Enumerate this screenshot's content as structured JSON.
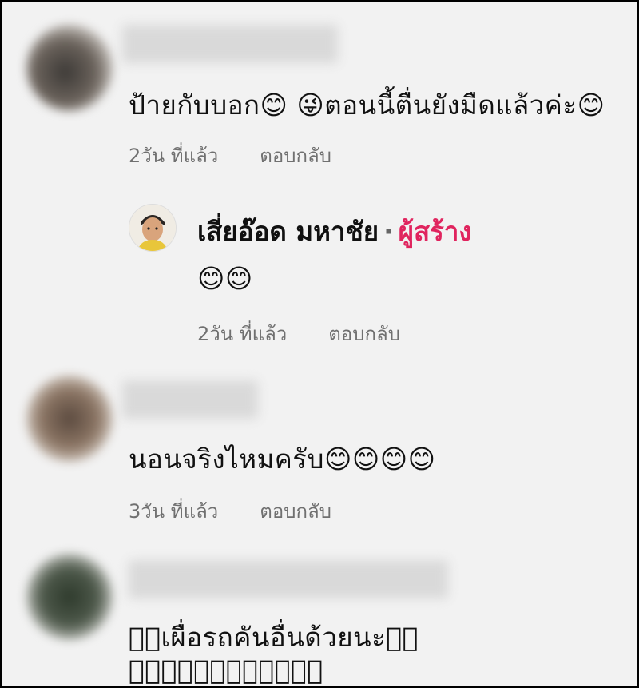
{
  "comments": [
    {
      "text": "ป้ายกับบอก😊 😜ตอนนี้ตื่นยังมืดแล้วค่ะ😊",
      "time": "2วัน ที่แล้ว",
      "reply": "ตอบกลับ",
      "avatar_color": "#4a4743"
    },
    {
      "text": "นอนจริงไหมครับ😊😊😊😊",
      "time": "3วัน ที่แล้ว",
      "reply": "ตอบกลับ",
      "avatar_color": "#5b4a3f"
    },
    {
      "text_line1": "􀀀􀀀เผื่อรถคันอื่นด้วยนะ􀀀􀀀",
      "text_line2": "􀀀􀀀􀀀􀀀􀀀􀀀􀀀􀀀􀀀􀀀􀀀􀀀",
      "avatar_color": "#2e3a2c"
    }
  ],
  "creator_reply": {
    "name": "เสี่ยอ๊อด มหาชัย",
    "separator": "·",
    "badge": "ผู้สร้าง",
    "text": "😊😊",
    "time": "2วัน ที่แล้ว",
    "reply": "ตอบกลับ",
    "badge_color": "#e0245e"
  }
}
